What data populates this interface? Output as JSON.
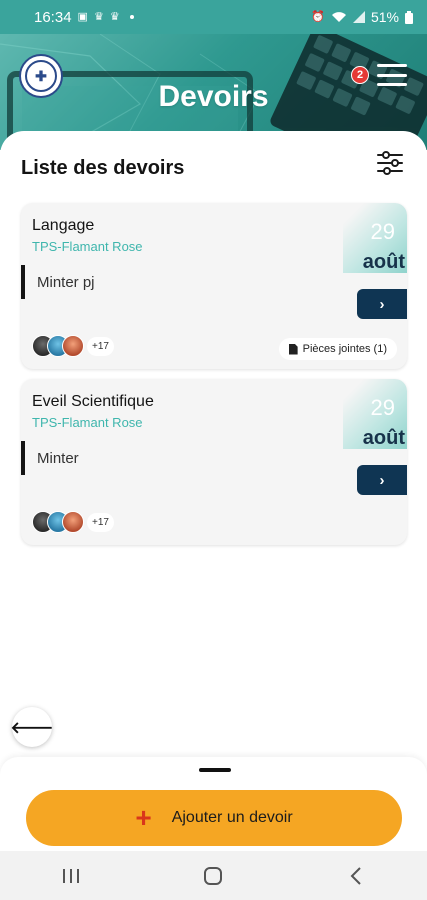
{
  "status_bar": {
    "time": "16:34",
    "battery": "51%",
    "icons": [
      "image-icon",
      "crown-icon",
      "crown-icon",
      "dot-icon",
      "alarm-icon",
      "wifi-icon",
      "signal-icon",
      "battery-icon"
    ]
  },
  "header": {
    "title": "Devoirs",
    "notification_count": "2",
    "colors": {
      "primary": "#2f9990",
      "accent": "#3fb6ad"
    }
  },
  "list": {
    "title": "Liste des devoirs"
  },
  "homework": [
    {
      "subject": "Langage",
      "class": "TPS-Flamant Rose",
      "description": "Minter pj",
      "day": "29",
      "month": "août",
      "more_count": "+17",
      "attachments_label": "Pièces jointes (1)"
    },
    {
      "subject": "Eveil Scientifique",
      "class": "TPS-Flamant Rose",
      "description": "Minter",
      "day": "29",
      "month": "août",
      "more_count": "+17"
    }
  ],
  "actions": {
    "add_label": "Ajouter un devoir",
    "add_color": "#f5a623"
  },
  "navbar": {
    "icons": [
      "recent-apps-icon",
      "home-icon",
      "back-icon"
    ]
  }
}
